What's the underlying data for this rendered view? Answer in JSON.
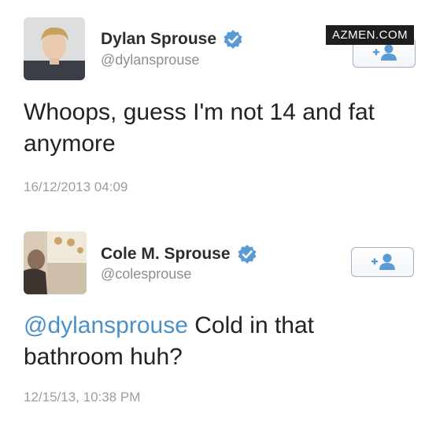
{
  "watermark": "AZMEN.COM",
  "tweets": [
    {
      "name": "Dylan Sprouse",
      "handle": "@dylansprouse",
      "text": "Whoops, guess I'm not 14 and fat anymore",
      "timestamp": "16/12/2013 04:09",
      "avatar_icon": "user-avatar-photo",
      "verified_icon": "verified-badge-icon",
      "follow_icon": "follow-user-icon"
    },
    {
      "name": "Cole M. Sprouse",
      "handle": "@colesprouse",
      "mention": "@dylansprouse",
      "text_rest": " Cold in that bathroom huh?",
      "timestamp": "12/15/13, 10:38 PM",
      "avatar_icon": "user-avatar-photo",
      "verified_icon": "verified-badge-icon",
      "follow_icon": "follow-user-icon"
    }
  ],
  "colors": {
    "verified": "#5b9bd5",
    "mention": "#4a90c9",
    "follow_icon": "#5b9bd5"
  }
}
